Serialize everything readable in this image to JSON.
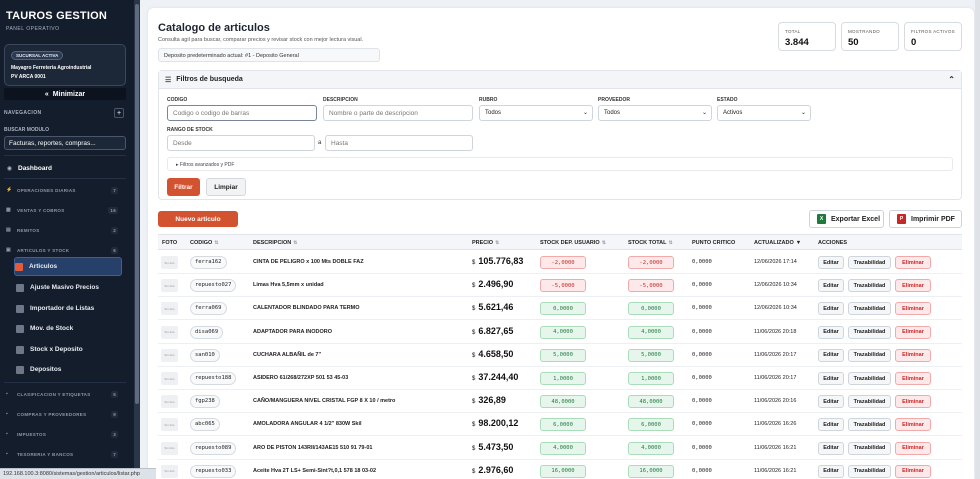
{
  "sidebar": {
    "brand": "TAUROS GESTION",
    "brand_sub": "PANEL OPERATIVO",
    "branch_badge": "SUCURSAL ACTIVA",
    "branch_name": "Mayagro Ferreteria Agroindustrial",
    "branch_pv": "PV ARCA 0001",
    "minimize_label": "Minimizar",
    "nav_title": "NAVEGACION",
    "nav_plus": "+",
    "search_label": "BUSCAR MODULO",
    "search_placeholder": "Facturas, reportes, compras...",
    "dashboard": "Dashboard",
    "sections": [
      {
        "label": "OPERACIONES DIARIAS",
        "count": "7"
      },
      {
        "label": "VENTAS Y COBROS",
        "count": "16"
      },
      {
        "label": "REMITOS",
        "count": "2"
      },
      {
        "label": "ARTICULOS Y STOCK",
        "count": "6"
      }
    ],
    "sub_items": [
      {
        "label": "Articulos",
        "active": true
      },
      {
        "label": "Ajuste Masivo Precios",
        "active": false
      },
      {
        "label": "Importador de Listas",
        "active": false
      },
      {
        "label": "Mov. de Stock",
        "active": false
      },
      {
        "label": "Stock x Deposito",
        "active": false
      },
      {
        "label": "Depositos",
        "active": false
      }
    ],
    "sections_bottom": [
      {
        "label": "CLASIFICACION Y ETIQUETAS",
        "count": "5"
      },
      {
        "label": "COMPRAS Y PROVEEDORES",
        "count": "9"
      },
      {
        "label": "IMPUESTOS",
        "count": "3"
      },
      {
        "label": "TESORERIA Y BANCOS",
        "count": "7"
      }
    ]
  },
  "status_url": "192.168.100.3:8080/sistemas/gestion/articulos/listar.php",
  "header": {
    "title": "Catalogo de articulos",
    "subtitle": "Consulta agil para buscar, comparar precios y revisar stock con mejor lectura visual.",
    "deposit": "Deposito predeterminado actual: #1 - Deposito General"
  },
  "stats": [
    {
      "label": "TOTAL",
      "value": "3.844"
    },
    {
      "label": "MOSTRANDO",
      "value": "50"
    },
    {
      "label": "FILTROS ACTIVOS",
      "value": "0"
    }
  ],
  "filters": {
    "title": "Filtros de busqueda",
    "codigo_label": "CODIGO",
    "codigo_placeholder": "Codigo o codigo de barras",
    "descripcion_label": "DESCRIPCION",
    "descripcion_placeholder": "Nombre o parte de descripcion",
    "rubro_label": "RUBRO",
    "rubro_value": "Todos",
    "proveedor_label": "PROVEEDOR",
    "proveedor_value": "Todos",
    "estado_label": "ESTADO",
    "estado_value": "Activos",
    "rango_label": "RANGO DE STOCK",
    "desde_placeholder": "Desde",
    "rango_sep": "a",
    "hasta_placeholder": "Hasta",
    "advanced": "Filtros avanzados y PDF",
    "filter_btn": "Filtrar",
    "clear_btn": "Limpiar"
  },
  "toolbar": {
    "new_btn": "Nuevo articulo",
    "export_btn": "Exportar Excel",
    "pdf_btn": "Imprimir PDF"
  },
  "table": {
    "headers": {
      "foto": "FOTO",
      "codigo": "CODIGO",
      "descripcion": "DESCRIPCION",
      "precio": "PRECIO",
      "stock_dep": "STOCK DEP. USUARIO",
      "stock_total": "STOCK TOTAL",
      "punto": "PUNTO CRITICO",
      "actualizado": "ACTUALIZADO",
      "acciones": "ACCIONES"
    },
    "photo_text": "Sin foto",
    "currency": "$",
    "actions": {
      "edit": "Editar",
      "trace": "Trazabilidad",
      "delete": "Eliminar"
    },
    "rows": [
      {
        "codigo": "ferra162",
        "descripcion": "CINTA DE PELIGRO x 100 Mts DOBLE FAZ",
        "precio": "105.776,83",
        "stock_dep": "-2,0000",
        "stock_total": "-2,0000",
        "critico": "0,0000",
        "actualizado": "12/06/2026 17:14"
      },
      {
        "codigo": "repuesto027",
        "descripcion": "Limas Hva 5,5mm x unidad",
        "precio": "2.496,90",
        "stock_dep": "-5,0000",
        "stock_total": "-5,0000",
        "critico": "0,0000",
        "actualizado": "12/06/2026 10:34"
      },
      {
        "codigo": "ferra069",
        "descripcion": "CALENTADOR BLINDADO PARA TERMO",
        "precio": "5.621,46",
        "stock_dep": "0,0000",
        "stock_total": "0,0000",
        "critico": "0,0000",
        "actualizado": "12/06/2026 10:34"
      },
      {
        "codigo": "disa069",
        "descripcion": "ADAPTADOR PARA INODORO",
        "precio": "6.827,65",
        "stock_dep": "4,0000",
        "stock_total": "4,0000",
        "critico": "0,0000",
        "actualizado": "11/06/2026 20:18"
      },
      {
        "codigo": "san010",
        "descripcion": "CUCHARA ALBAÑIL de 7\"",
        "precio": "4.658,50",
        "stock_dep": "5,0000",
        "stock_total": "5,0000",
        "critico": "0,0000",
        "actualizado": "11/06/2026 20:17"
      },
      {
        "codigo": "repuesto188",
        "descripcion": "ASIDERO 61/268/272XP 501 53 45-03",
        "precio": "37.244,40",
        "stock_dep": "1,0000",
        "stock_total": "1,0000",
        "critico": "0,0000",
        "actualizado": "11/06/2026 20:17"
      },
      {
        "codigo": "fgp238",
        "descripcion": "CAÑO/MANGUERA NIVEL CRISTAL FGP 8 X 10 / metro",
        "precio": "326,89",
        "stock_dep": "48,0000",
        "stock_total": "48,0000",
        "critico": "0,0000",
        "actualizado": "11/06/2026 20:16"
      },
      {
        "codigo": "abc065",
        "descripcion": "AMOLADORA ANGULAR 4 1/2\" 830W Skil",
        "precio": "98.200,12",
        "stock_dep": "6,0000",
        "stock_total": "6,0000",
        "critico": "0,0000",
        "actualizado": "11/06/2026 16:26"
      },
      {
        "codigo": "repuesto089",
        "descripcion": "ARO DE PISTON 143RII/143AE15 510 91 79-01",
        "precio": "5.473,50",
        "stock_dep": "4,0000",
        "stock_total": "4,0000",
        "critico": "0,0000",
        "actualizado": "11/06/2026 16:21"
      },
      {
        "codigo": "repuesto033",
        "descripcion": "Aceite Hva 2T LS+ Semi-Sint?t,0,1 578 18 03-02",
        "precio": "2.976,60",
        "stock_dep": "16,0000",
        "stock_total": "16,0000",
        "critico": "0,0000",
        "actualizado": "11/06/2026 16:21"
      }
    ]
  }
}
